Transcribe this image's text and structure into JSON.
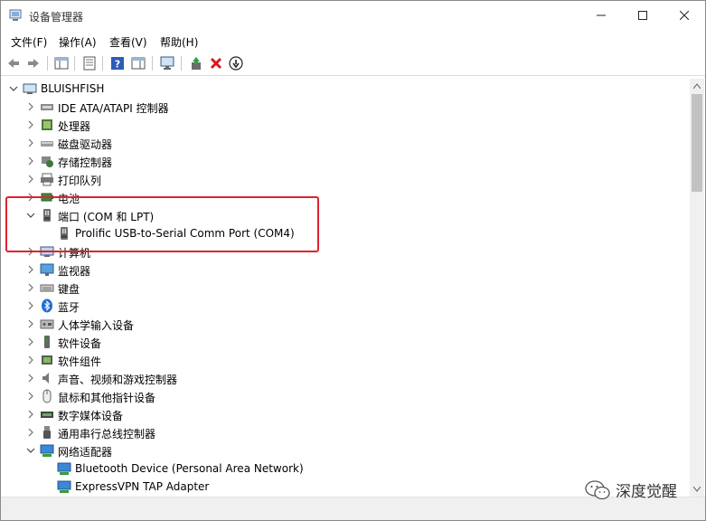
{
  "window": {
    "title": "设备管理器"
  },
  "menu": [
    "文件(F)",
    "操作(A)",
    "查看(V)",
    "帮助(H)"
  ],
  "tree": {
    "root": "BLUISHFISH",
    "categories": [
      {
        "label": "IDE ATA/ATAPI 控制器",
        "icon": "ide-controller-icon"
      },
      {
        "label": "处理器",
        "icon": "processor-icon"
      },
      {
        "label": "磁盘驱动器",
        "icon": "disk-drive-icon"
      },
      {
        "label": "存储控制器",
        "icon": "storage-controller-icon"
      },
      {
        "label": "打印队列",
        "icon": "printer-icon"
      },
      {
        "label": "电池",
        "icon": "battery-icon"
      },
      {
        "label": "端口 (COM 和 LPT)",
        "icon": "port-icon",
        "expanded": true,
        "children": [
          {
            "label": "Prolific USB-to-Serial Comm Port (COM4)",
            "icon": "port-icon"
          }
        ]
      },
      {
        "label": "计算机",
        "icon": "computer-icon"
      },
      {
        "label": "监视器",
        "icon": "monitor-icon"
      },
      {
        "label": "键盘",
        "icon": "keyboard-icon"
      },
      {
        "label": "蓝牙",
        "icon": "bluetooth-icon"
      },
      {
        "label": "人体学输入设备",
        "icon": "hid-icon"
      },
      {
        "label": "软件设备",
        "icon": "software-device-icon"
      },
      {
        "label": "软件组件",
        "icon": "software-component-icon"
      },
      {
        "label": "声音、视频和游戏控制器",
        "icon": "sound-icon"
      },
      {
        "label": "鼠标和其他指针设备",
        "icon": "mouse-icon"
      },
      {
        "label": "数字媒体设备",
        "icon": "digital-media-icon"
      },
      {
        "label": "通用串行总线控制器",
        "icon": "usb-icon"
      },
      {
        "label": "网络适配器",
        "icon": "network-adapter-icon",
        "expanded": true,
        "children": [
          {
            "label": "Bluetooth Device (Personal Area Network)",
            "icon": "network-adapter-icon"
          },
          {
            "label": "ExpressVPN TAP Adapter",
            "icon": "network-adapter-icon"
          }
        ]
      }
    ]
  },
  "watermark": "深度觉醒",
  "colors": {
    "highlight": "#e0212f",
    "accent": "#2a7fd4"
  }
}
